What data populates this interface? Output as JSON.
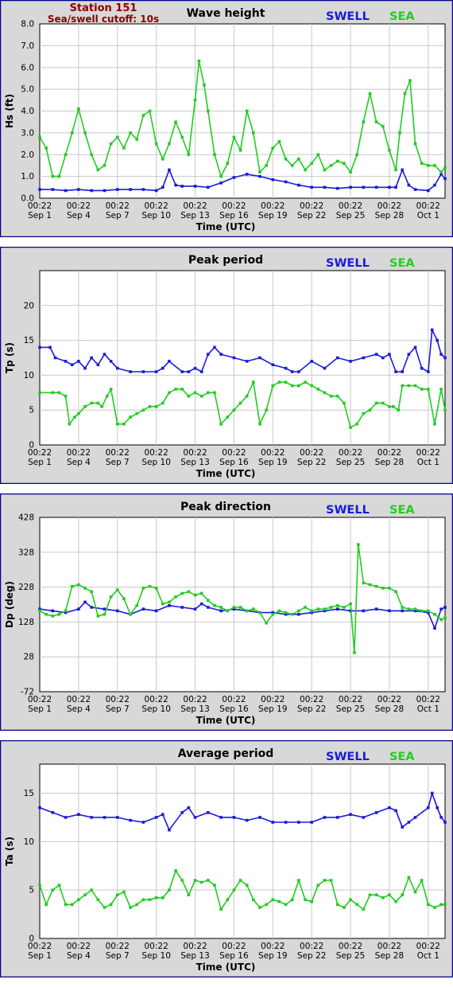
{
  "station": {
    "name": "Station 151",
    "cutoff": "Sea/swell cutoff: 10s"
  },
  "colors": {
    "swell": "#1a1adb",
    "sea": "#22cc22",
    "frame": "#000088",
    "plot_bg": "#ffffff",
    "outer_bg": "#d8d8d8",
    "grid": "#c8c8c8",
    "station_text": "#8b0000"
  },
  "legend": {
    "swell": "SWELL",
    "sea": "SEA"
  },
  "chart_data": [
    {
      "type": "line",
      "title": "Wave height",
      "xlabel": "Time (UTC)",
      "ylabel": "Hs (ft)",
      "ylim": [
        0,
        8
      ],
      "yticks": [
        "0.0",
        "1.0",
        "2.0",
        "3.0",
        "4.0",
        "5.0",
        "6.0",
        "7.0",
        "8.0"
      ],
      "x_ticks": [
        {
          "day": 0,
          "time": "00:22",
          "date": "Sep 1"
        },
        {
          "day": 3,
          "time": "00:22",
          "date": "Sep 4"
        },
        {
          "day": 6,
          "time": "00:22",
          "date": "Sep 7"
        },
        {
          "day": 9,
          "time": "00:22",
          "date": "Sep 10"
        },
        {
          "day": 12,
          "time": "00:22",
          "date": "Sep 13"
        },
        {
          "day": 15,
          "time": "00:22",
          "date": "Sep 16"
        },
        {
          "day": 18,
          "time": "00:22",
          "date": "Sep 19"
        },
        {
          "day": 21,
          "time": "00:22",
          "date": "Sep 22"
        },
        {
          "day": 24,
          "time": "00:22",
          "date": "Sep 25"
        },
        {
          "day": 27,
          "time": "00:22",
          "date": "Sep 28"
        },
        {
          "day": 30,
          "time": "00:22",
          "date": "Oct 1"
        }
      ],
      "xlim": [
        0,
        31.3
      ],
      "grid": true,
      "legend_position": "top-right",
      "series": [
        {
          "name": "SWELL",
          "color_key": "swell",
          "x": [
            0,
            1,
            2,
            3,
            4,
            5,
            6,
            7,
            8,
            9,
            9.5,
            10,
            10.5,
            11,
            12,
            13,
            14,
            15,
            16,
            17,
            18,
            19,
            20,
            21,
            22,
            23,
            24,
            25,
            26,
            27,
            27.5,
            28,
            28.5,
            29,
            30,
            30.5,
            31,
            31.3
          ],
          "y": [
            0.4,
            0.4,
            0.35,
            0.4,
            0.35,
            0.35,
            0.4,
            0.4,
            0.4,
            0.35,
            0.5,
            1.3,
            0.6,
            0.55,
            0.55,
            0.5,
            0.7,
            0.95,
            1.1,
            1.0,
            0.85,
            0.75,
            0.6,
            0.5,
            0.5,
            0.45,
            0.5,
            0.5,
            0.5,
            0.5,
            0.5,
            1.3,
            0.6,
            0.4,
            0.35,
            0.6,
            1.1,
            0.9
          ]
        },
        {
          "name": "SEA",
          "color_key": "sea",
          "x": [
            0,
            0.5,
            1,
            1.5,
            2,
            2.5,
            3,
            3.5,
            4,
            4.5,
            5,
            5.5,
            6,
            6.5,
            7,
            7.5,
            8,
            8.5,
            9,
            9.5,
            10,
            10.5,
            11,
            11.5,
            12,
            12.3,
            12.7,
            13,
            13.5,
            14,
            14.5,
            15,
            15.5,
            16,
            16.5,
            17,
            17.5,
            18,
            18.5,
            19,
            19.5,
            20,
            20.5,
            21,
            21.5,
            22,
            22.5,
            23,
            23.5,
            24,
            24.5,
            25,
            25.5,
            26,
            26.5,
            27,
            27.5,
            27.8,
            28.2,
            28.6,
            29,
            29.5,
            30,
            30.5,
            31,
            31.3
          ],
          "y": [
            2.8,
            2.3,
            1.0,
            1.0,
            2.0,
            3.0,
            4.1,
            3.0,
            2.0,
            1.3,
            1.5,
            2.5,
            2.8,
            2.3,
            3.0,
            2.7,
            3.8,
            4.0,
            2.5,
            1.8,
            2.5,
            3.5,
            2.8,
            2.0,
            4.5,
            6.3,
            5.2,
            4.0,
            2.0,
            1.0,
            1.6,
            2.8,
            2.2,
            4.0,
            3.0,
            1.2,
            1.5,
            2.3,
            2.6,
            1.8,
            1.5,
            1.8,
            1.3,
            1.6,
            2.0,
            1.3,
            1.5,
            1.7,
            1.6,
            1.2,
            2.0,
            3.5,
            4.8,
            3.5,
            3.3,
            2.2,
            1.3,
            3.0,
            4.8,
            5.4,
            2.5,
            1.6,
            1.5,
            1.5,
            1.2,
            1.4
          ]
        }
      ]
    },
    {
      "type": "line",
      "title": "Peak period",
      "xlabel": "Time (UTC)",
      "ylabel": "Tp (s)",
      "ylim": [
        0,
        25
      ],
      "yticks": [
        "0",
        "5",
        "10",
        "15",
        "20"
      ],
      "xlim": [
        0,
        31.3
      ],
      "grid": true,
      "legend_position": "top-right",
      "series": [
        {
          "name": "SWELL",
          "color_key": "swell",
          "x": [
            0,
            0.8,
            1.2,
            2,
            2.5,
            3,
            3.5,
            4,
            4.5,
            5,
            5.5,
            6,
            7,
            8,
            9,
            9.5,
            10,
            11,
            11.5,
            12,
            12.5,
            13,
            13.5,
            14,
            15,
            16,
            17,
            18,
            19,
            19.5,
            20,
            21,
            22,
            23,
            24,
            25,
            26,
            26.5,
            27,
            27.5,
            28,
            28.5,
            29,
            29.5,
            30,
            30.3,
            30.7,
            31,
            31.3
          ],
          "y": [
            14,
            14,
            12.5,
            12,
            11.5,
            12,
            11,
            12.5,
            11.5,
            13,
            12,
            11,
            10.5,
            10.5,
            10.5,
            11,
            12,
            10.5,
            10.5,
            11,
            10.5,
            13,
            14,
            13,
            12.5,
            12,
            12.5,
            11.5,
            11,
            10.5,
            10.5,
            12,
            11,
            12.5,
            12,
            12.5,
            13,
            12.5,
            13,
            10.5,
            10.5,
            13,
            14,
            11,
            10.5,
            16.5,
            15,
            13,
            12.5
          ]
        },
        {
          "name": "SEA",
          "color_key": "sea",
          "x": [
            0,
            1,
            1.5,
            2,
            2.3,
            2.7,
            3,
            3.5,
            4,
            4.5,
            4.8,
            5.2,
            5.5,
            6,
            6.5,
            7,
            7.5,
            8,
            8.5,
            9,
            9.5,
            10,
            10.5,
            11,
            11.5,
            12,
            12.5,
            13,
            13.5,
            14,
            14.5,
            15,
            15.5,
            16,
            16.5,
            17,
            17.5,
            18,
            18.5,
            19,
            19.5,
            20,
            20.5,
            21,
            21.5,
            22,
            22.5,
            23,
            23.5,
            24,
            24.5,
            25,
            25.5,
            26,
            26.5,
            27,
            27.3,
            27.7,
            28,
            28.5,
            29,
            29.5,
            30,
            30.5,
            31,
            31.3
          ],
          "y": [
            7.5,
            7.5,
            7.5,
            7,
            3,
            4,
            4.5,
            5.5,
            6,
            6,
            5.5,
            7,
            8,
            3,
            3,
            4,
            4.5,
            5,
            5.5,
            5.5,
            6,
            7.5,
            8,
            8,
            7,
            7.5,
            7,
            7.5,
            7.5,
            3,
            4,
            5,
            6,
            7,
            9,
            3,
            5,
            8.5,
            9,
            9,
            8.5,
            8.5,
            9,
            8.5,
            8,
            7.5,
            7,
            7,
            6,
            2.5,
            3,
            4.5,
            5,
            6,
            6,
            5.5,
            5.5,
            5,
            8.5,
            8.5,
            8.5,
            8,
            8,
            3,
            8,
            5
          ]
        }
      ]
    },
    {
      "type": "line",
      "title": "Peak direction",
      "xlabel": "Time (UTC)",
      "ylabel": "Dp (deg)",
      "ylim": [
        -72,
        428
      ],
      "yticks": [
        "-72",
        "28",
        "128",
        "228",
        "328",
        "428"
      ],
      "xlim": [
        0,
        31.3
      ],
      "grid": true,
      "legend_position": "top-right",
      "series": [
        {
          "name": "SWELL",
          "color_key": "swell",
          "x": [
            0,
            1,
            2,
            3,
            3.5,
            4,
            5,
            6,
            7,
            8,
            9,
            10,
            11,
            12,
            12.5,
            13,
            14,
            15,
            16,
            17,
            18,
            19,
            20,
            21,
            22,
            23,
            24,
            25,
            26,
            27,
            28,
            29,
            30,
            30.5,
            31,
            31.3
          ],
          "y": [
            165,
            160,
            155,
            165,
            185,
            170,
            165,
            160,
            150,
            165,
            160,
            175,
            170,
            165,
            180,
            170,
            160,
            165,
            160,
            155,
            155,
            150,
            150,
            155,
            160,
            165,
            160,
            160,
            165,
            160,
            160,
            160,
            155,
            110,
            165,
            170
          ]
        },
        {
          "name": "SEA",
          "color_key": "sea",
          "x": [
            0,
            0.5,
            1,
            1.5,
            2,
            2.5,
            3,
            3.5,
            4,
            4.5,
            5,
            5.5,
            6,
            6.5,
            7,
            7.5,
            8,
            8.5,
            9,
            9.5,
            10,
            10.5,
            11,
            11.5,
            12,
            12.5,
            13,
            13.5,
            14,
            14.5,
            15,
            15.5,
            16,
            16.5,
            17,
            17.5,
            18,
            18.5,
            19,
            19.5,
            20,
            20.5,
            21,
            21.5,
            22,
            22.5,
            23,
            23.5,
            24,
            24.3,
            24.6,
            25,
            25.5,
            26,
            26.5,
            27,
            27.5,
            28,
            28.5,
            29,
            29.5,
            30,
            30.5,
            31,
            31.3
          ],
          "y": [
            160,
            150,
            145,
            150,
            160,
            230,
            235,
            225,
            215,
            145,
            150,
            200,
            220,
            195,
            150,
            175,
            225,
            230,
            225,
            180,
            185,
            200,
            210,
            215,
            205,
            210,
            190,
            175,
            170,
            160,
            170,
            170,
            160,
            165,
            155,
            125,
            150,
            160,
            155,
            150,
            160,
            170,
            160,
            165,
            165,
            170,
            175,
            170,
            180,
            40,
            350,
            240,
            235,
            230,
            225,
            225,
            215,
            170,
            165,
            165,
            160,
            160,
            150,
            135,
            140
          ]
        }
      ]
    },
    {
      "type": "line",
      "title": "Average period",
      "xlabel": "Time (UTC)",
      "ylabel": "Ta (s)",
      "ylim": [
        0,
        18
      ],
      "yticks": [
        "0",
        "5",
        "10",
        "15"
      ],
      "xlim": [
        0,
        31.3
      ],
      "grid": true,
      "legend_position": "top-right",
      "series": [
        {
          "name": "SWELL",
          "color_key": "swell",
          "x": [
            0,
            1,
            2,
            3,
            4,
            5,
            6,
            7,
            8,
            9,
            9.5,
            10,
            11,
            11.5,
            12,
            13,
            14,
            15,
            16,
            17,
            18,
            19,
            20,
            21,
            22,
            23,
            24,
            25,
            26,
            27,
            27.5,
            28,
            28.5,
            29,
            30,
            30.3,
            30.7,
            31,
            31.3
          ],
          "y": [
            13.5,
            13,
            12.5,
            12.8,
            12.5,
            12.5,
            12.5,
            12.2,
            12,
            12.5,
            12.8,
            11.2,
            13,
            13.5,
            12.5,
            13,
            12.5,
            12.5,
            12.2,
            12.5,
            12,
            12,
            12,
            12,
            12.5,
            12.5,
            12.8,
            12.5,
            13,
            13.5,
            13.2,
            11.5,
            12,
            12.5,
            13.5,
            15,
            13.5,
            12.5,
            12
          ]
        },
        {
          "name": "SEA",
          "color_key": "sea",
          "x": [
            0,
            0.5,
            1,
            1.5,
            2,
            2.5,
            3,
            3.5,
            4,
            4.5,
            5,
            5.5,
            6,
            6.5,
            7,
            7.5,
            8,
            8.5,
            9,
            9.5,
            10,
            10.5,
            11,
            11.5,
            12,
            12.5,
            13,
            13.5,
            14,
            14.5,
            15,
            15.5,
            16,
            16.5,
            17,
            17.5,
            18,
            18.5,
            19,
            19.5,
            20,
            20.5,
            21,
            21.5,
            22,
            22.5,
            23,
            23.5,
            24,
            24.5,
            25,
            25.5,
            26,
            26.5,
            27,
            27.5,
            28,
            28.5,
            29,
            29.5,
            30,
            30.5,
            31,
            31.3
          ],
          "y": [
            5.5,
            3.5,
            5,
            5.5,
            3.5,
            3.5,
            4,
            4.5,
            5,
            4,
            3.2,
            3.5,
            4.5,
            4.8,
            3.2,
            3.5,
            4,
            4,
            4.2,
            4.2,
            5,
            7,
            6,
            4.5,
            6,
            5.8,
            6,
            5.5,
            3,
            4,
            5,
            6,
            5.5,
            4,
            3.2,
            3.5,
            4,
            3.8,
            3.5,
            4,
            6,
            4,
            3.8,
            5.5,
            6,
            6,
            3.5,
            3.2,
            4,
            3.5,
            3,
            4.5,
            4.5,
            4.2,
            4.5,
            3.8,
            4.5,
            6.3,
            4.8,
            6,
            3.5,
            3.2,
            3.5,
            3.5
          ]
        }
      ]
    }
  ]
}
